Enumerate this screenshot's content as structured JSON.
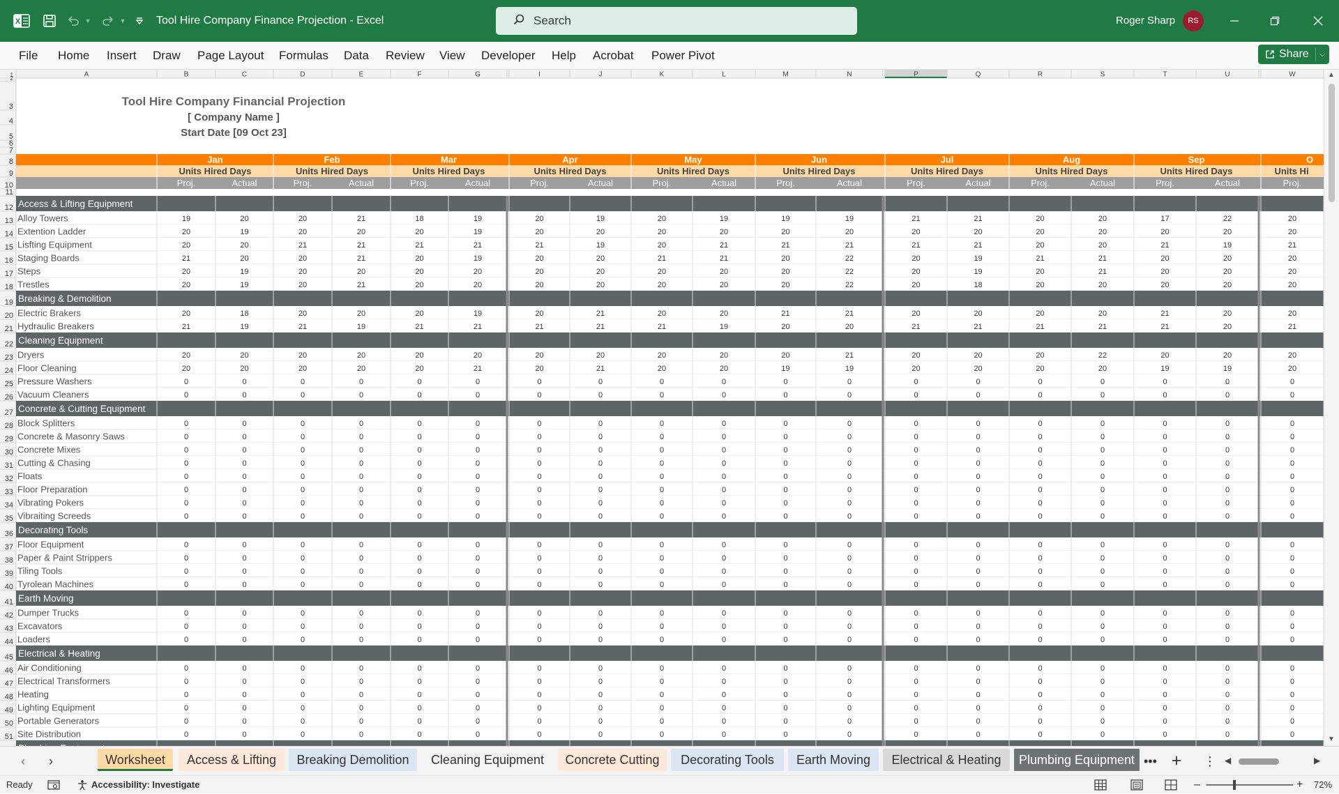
{
  "app": {
    "doc_title": "Tool Hire Company Finance Projection  -  Excel",
    "search_placeholder": "Search",
    "user_name": "Roger Sharp",
    "user_initials": "RS",
    "accent": "#1f7a43"
  },
  "menu": [
    "File",
    "Home",
    "Insert",
    "Draw",
    "Page Layout",
    "Formulas",
    "Data",
    "Review",
    "View",
    "Developer",
    "Help",
    "Acrobat",
    "Power Pivot"
  ],
  "share_label": "Share",
  "sheet": {
    "title": "Tool Hire Company Financial Projection",
    "company": "[ Company Name ]",
    "start_date": "Start Date [09 Oct 23]",
    "col_letters": [
      "A",
      "B",
      "C",
      "D",
      "E",
      "F",
      "G",
      "",
      "I",
      "J",
      "K",
      "L",
      "M",
      "N",
      "",
      "P",
      "Q",
      "R",
      "S",
      "T",
      "U",
      "",
      "W"
    ],
    "selected_col": "P",
    "months": [
      "Jan",
      "Feb",
      "Mar",
      "Apr",
      "May",
      "Jun",
      "Jul",
      "Aug",
      "Sep",
      "O"
    ],
    "subheader": "Units Hired Days",
    "last_subheader": "Units Hi",
    "proj_label": "Proj.",
    "actual_label": "Actual",
    "colors": {
      "orange": "#ff7f00",
      "peach": "#ffd9a6",
      "grey_header": "#9e9e9e",
      "category_bar": "#5d6565"
    },
    "sections": [
      {
        "row": 12,
        "name": "Access & Lifting Equipment",
        "items": [
          {
            "row": 13,
            "name": "Alloy Towers",
            "values": [
              19,
              20,
              20,
              21,
              18,
              19,
              20,
              19,
              20,
              19,
              19,
              19,
              21,
              21,
              20,
              20,
              17,
              22,
              20
            ]
          },
          {
            "row": 14,
            "name": "Extention Ladder",
            "values": [
              20,
              19,
              20,
              20,
              20,
              19,
              20,
              20,
              20,
              20,
              20,
              20,
              20,
              20,
              20,
              20,
              20,
              20,
              20
            ]
          },
          {
            "row": 15,
            "name": "Lisfting Equipment",
            "values": [
              20,
              20,
              21,
              21,
              21,
              21,
              21,
              19,
              20,
              21,
              21,
              21,
              21,
              21,
              20,
              20,
              21,
              19,
              21
            ]
          },
          {
            "row": 16,
            "name": "Staging Boards",
            "values": [
              21,
              20,
              20,
              21,
              20,
              19,
              20,
              20,
              21,
              21,
              20,
              22,
              20,
              19,
              21,
              21,
              20,
              20,
              20
            ]
          },
          {
            "row": 17,
            "name": "Steps",
            "values": [
              20,
              19,
              20,
              20,
              20,
              20,
              20,
              20,
              20,
              20,
              20,
              22,
              20,
              19,
              20,
              21,
              20,
              20,
              20
            ]
          },
          {
            "row": 18,
            "name": "Trestles",
            "values": [
              20,
              19,
              20,
              21,
              20,
              20,
              20,
              20,
              20,
              20,
              20,
              22,
              20,
              18,
              20,
              20,
              20,
              20,
              20
            ]
          }
        ]
      },
      {
        "row": 19,
        "name": "Breaking & Demolition",
        "items": [
          {
            "row": 20,
            "name": "Electric Brakers",
            "values": [
              20,
              18,
              20,
              20,
              20,
              19,
              20,
              21,
              20,
              20,
              21,
              21,
              20,
              20,
              20,
              20,
              21,
              20,
              20
            ]
          },
          {
            "row": 21,
            "name": "Hydraulic Breakers",
            "values": [
              21,
              19,
              21,
              19,
              21,
              21,
              21,
              21,
              21,
              19,
              20,
              20,
              21,
              21,
              21,
              21,
              21,
              20,
              21
            ]
          }
        ]
      },
      {
        "row": 22,
        "name": "Cleaning Equipment",
        "items": [
          {
            "row": 23,
            "name": "Dryers",
            "values": [
              20,
              20,
              20,
              20,
              20,
              20,
              20,
              20,
              20,
              20,
              20,
              21,
              20,
              20,
              20,
              22,
              20,
              20,
              20
            ]
          },
          {
            "row": 24,
            "name": "Floor Cleaning",
            "values": [
              20,
              20,
              20,
              20,
              20,
              21,
              20,
              21,
              20,
              20,
              19,
              19,
              20,
              20,
              20,
              20,
              19,
              19,
              20
            ]
          },
          {
            "row": 25,
            "name": "Pressure Washers",
            "values": [
              0,
              0,
              0,
              0,
              0,
              0,
              0,
              0,
              0,
              0,
              0,
              0,
              0,
              0,
              0,
              0,
              0,
              0,
              0
            ]
          },
          {
            "row": 26,
            "name": "Vacuum Cleaners",
            "values": [
              0,
              0,
              0,
              0,
              0,
              0,
              0,
              0,
              0,
              0,
              0,
              0,
              0,
              0,
              0,
              0,
              0,
              0,
              0
            ]
          }
        ]
      },
      {
        "row": 27,
        "name": "Concrete & Cutting Equipment",
        "items": [
          {
            "row": 28,
            "name": "Block Splitters",
            "values": [
              0,
              0,
              0,
              0,
              0,
              0,
              0,
              0,
              0,
              0,
              0,
              0,
              0,
              0,
              0,
              0,
              0,
              0,
              0
            ]
          },
          {
            "row": 29,
            "name": "Concrete & Masonry Saws",
            "values": [
              0,
              0,
              0,
              0,
              0,
              0,
              0,
              0,
              0,
              0,
              0,
              0,
              0,
              0,
              0,
              0,
              0,
              0,
              0
            ]
          },
          {
            "row": 30,
            "name": "Concrete Mixes",
            "values": [
              0,
              0,
              0,
              0,
              0,
              0,
              0,
              0,
              0,
              0,
              0,
              0,
              0,
              0,
              0,
              0,
              0,
              0,
              0
            ]
          },
          {
            "row": 31,
            "name": "Cutting & Chasing",
            "values": [
              0,
              0,
              0,
              0,
              0,
              0,
              0,
              0,
              0,
              0,
              0,
              0,
              0,
              0,
              0,
              0,
              0,
              0,
              0
            ]
          },
          {
            "row": 32,
            "name": "Floats",
            "values": [
              0,
              0,
              0,
              0,
              0,
              0,
              0,
              0,
              0,
              0,
              0,
              0,
              0,
              0,
              0,
              0,
              0,
              0,
              0
            ]
          },
          {
            "row": 33,
            "name": "Floor Preparation",
            "values": [
              0,
              0,
              0,
              0,
              0,
              0,
              0,
              0,
              0,
              0,
              0,
              0,
              0,
              0,
              0,
              0,
              0,
              0,
              0
            ]
          },
          {
            "row": 34,
            "name": "Vibrating Pokers",
            "values": [
              0,
              0,
              0,
              0,
              0,
              0,
              0,
              0,
              0,
              0,
              0,
              0,
              0,
              0,
              0,
              0,
              0,
              0,
              0
            ]
          },
          {
            "row": 35,
            "name": "Vibraiting Screeds",
            "values": [
              0,
              0,
              0,
              0,
              0,
              0,
              0,
              0,
              0,
              0,
              0,
              0,
              0,
              0,
              0,
              0,
              0,
              0,
              0
            ]
          }
        ]
      },
      {
        "row": 36,
        "name": "Decorating Tools",
        "items": [
          {
            "row": 37,
            "name": "Floor Equipment",
            "values": [
              0,
              0,
              0,
              0,
              0,
              0,
              0,
              0,
              0,
              0,
              0,
              0,
              0,
              0,
              0,
              0,
              0,
              0,
              0
            ]
          },
          {
            "row": 38,
            "name": "Paper & Paint Strippers",
            "values": [
              0,
              0,
              0,
              0,
              0,
              0,
              0,
              0,
              0,
              0,
              0,
              0,
              0,
              0,
              0,
              0,
              0,
              0,
              0
            ]
          },
          {
            "row": 39,
            "name": "Tiling Tools",
            "values": [
              0,
              0,
              0,
              0,
              0,
              0,
              0,
              0,
              0,
              0,
              0,
              0,
              0,
              0,
              0,
              0,
              0,
              0,
              0
            ]
          },
          {
            "row": 40,
            "name": "Tyrolean Machines",
            "values": [
              0,
              0,
              0,
              0,
              0,
              0,
              0,
              0,
              0,
              0,
              0,
              0,
              0,
              0,
              0,
              0,
              0,
              0,
              0
            ]
          }
        ]
      },
      {
        "row": 41,
        "name": "Earth Moving",
        "items": [
          {
            "row": 42,
            "name": "Dumper Trucks",
            "values": [
              0,
              0,
              0,
              0,
              0,
              0,
              0,
              0,
              0,
              0,
              0,
              0,
              0,
              0,
              0,
              0,
              0,
              0,
              0
            ]
          },
          {
            "row": 43,
            "name": "Excavators",
            "values": [
              0,
              0,
              0,
              0,
              0,
              0,
              0,
              0,
              0,
              0,
              0,
              0,
              0,
              0,
              0,
              0,
              0,
              0,
              0
            ]
          },
          {
            "row": 44,
            "name": "Loaders",
            "values": [
              0,
              0,
              0,
              0,
              0,
              0,
              0,
              0,
              0,
              0,
              0,
              0,
              0,
              0,
              0,
              0,
              0,
              0,
              0
            ]
          }
        ]
      },
      {
        "row": 45,
        "name": "Electrical & Heating",
        "items": [
          {
            "row": 46,
            "name": "Air Conditioning",
            "values": [
              0,
              0,
              0,
              0,
              0,
              0,
              0,
              0,
              0,
              0,
              0,
              0,
              0,
              0,
              0,
              0,
              0,
              0,
              0
            ]
          },
          {
            "row": 47,
            "name": "Electrical Transformers",
            "values": [
              0,
              0,
              0,
              0,
              0,
              0,
              0,
              0,
              0,
              0,
              0,
              0,
              0,
              0,
              0,
              0,
              0,
              0,
              0
            ]
          },
          {
            "row": 48,
            "name": "Heating",
            "values": [
              0,
              0,
              0,
              0,
              0,
              0,
              0,
              0,
              0,
              0,
              0,
              0,
              0,
              0,
              0,
              0,
              0,
              0,
              0
            ]
          },
          {
            "row": 49,
            "name": "Lighting Equipment",
            "values": [
              0,
              0,
              0,
              0,
              0,
              0,
              0,
              0,
              0,
              0,
              0,
              0,
              0,
              0,
              0,
              0,
              0,
              0,
              0
            ]
          },
          {
            "row": 50,
            "name": "Portable Generators",
            "values": [
              0,
              0,
              0,
              0,
              0,
              0,
              0,
              0,
              0,
              0,
              0,
              0,
              0,
              0,
              0,
              0,
              0,
              0,
              0
            ]
          },
          {
            "row": 51,
            "name": "Site Distribution",
            "values": [
              0,
              0,
              0,
              0,
              0,
              0,
              0,
              0,
              0,
              0,
              0,
              0,
              0,
              0,
              0,
              0,
              0,
              0,
              0
            ]
          }
        ]
      },
      {
        "row": 52,
        "name": "Plumbing Equipment",
        "items": []
      }
    ]
  },
  "tabs": [
    {
      "label": "Worksheet",
      "bg": "#ffd9a6",
      "active": true
    },
    {
      "label": "Access & Lifting",
      "bg": "#fde9d9"
    },
    {
      "label": "Breaking Demolition",
      "bg": "#dce6f2"
    },
    {
      "label": "Cleaning Equipment",
      "bg": "#f3f3f3"
    },
    {
      "label": "Concrete Cutting",
      "bg": "#fde9d9"
    },
    {
      "label": "Decorating Tools",
      "bg": "#dce6f2"
    },
    {
      "label": "Earth Moving",
      "bg": "#dce6f2"
    },
    {
      "label": "Electrical & Heating",
      "bg": "#d9d9d9"
    },
    {
      "label": "Plumbing Equipment",
      "bg": "#6d7373",
      "fg": "#ffffff"
    }
  ],
  "tab_more": "•••",
  "status": {
    "ready": "Ready",
    "accessibility": "Accessibility: Investigate",
    "zoom": "72%"
  }
}
